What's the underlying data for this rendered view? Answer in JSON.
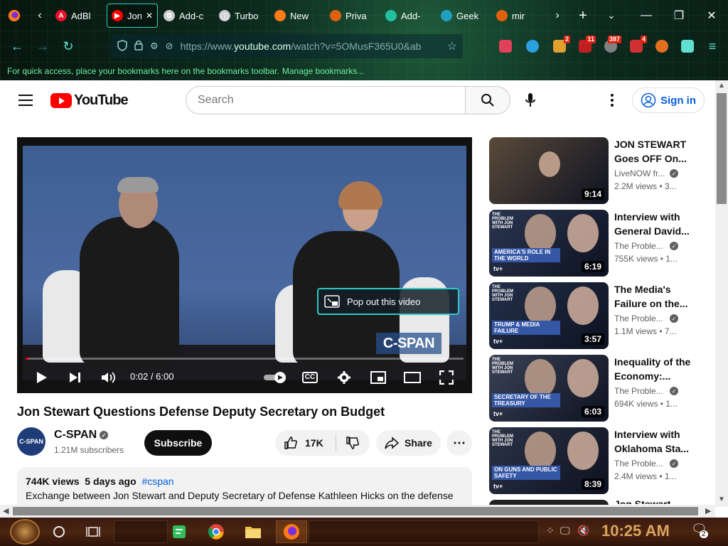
{
  "browser": {
    "tabs": [
      {
        "title": "AdBl",
        "color": "#e8102b",
        "letter": "A"
      },
      {
        "title": "Jon",
        "color": "#ff0000",
        "letter": "▶",
        "active": true
      },
      {
        "title": "Add-c",
        "color": "#cccccc",
        "letter": "⧉"
      },
      {
        "title": "Turbo",
        "color": "#cccccc",
        "letter": "ⓘ"
      },
      {
        "title": "New",
        "color": "#ff7a18",
        "letter": ""
      },
      {
        "title": "Priva",
        "color": "#e06010",
        "letter": ""
      },
      {
        "title": "Add-",
        "color": "#20c0a0",
        "letter": ""
      },
      {
        "title": "Geek",
        "color": "#20a0c0",
        "letter": ""
      },
      {
        "title": "mir",
        "color": "#e06010",
        "letter": ""
      }
    ],
    "url_prefix": "https://www.",
    "url_domain": "youtube.com",
    "url_rest": "/watch?v=5OMusF365U0&ab",
    "extensions": [
      {
        "name": "pocket-icon",
        "color": "#e0405a",
        "badge": ""
      },
      {
        "name": "circle-extension-icon",
        "color": "#2aa0e0",
        "badge": ""
      },
      {
        "name": "lightning-extension-icon",
        "color": "#e0a030",
        "badge": "2"
      },
      {
        "name": "ublock-icon",
        "color": "#c02020",
        "badge": "11"
      },
      {
        "name": "clock-extension-icon",
        "color": "#808080",
        "badge": "387"
      },
      {
        "name": "shield-extension-icon",
        "color": "#d03030",
        "badge": "4"
      },
      {
        "name": "brave-extension-icon",
        "color": "#e07020",
        "badge": ""
      },
      {
        "name": "puzzle-icon",
        "color": "#5fe0d0",
        "badge": ""
      }
    ],
    "bookmarks_text": "For quick access, place your bookmarks here on the bookmarks toolbar.",
    "bookmarks_link": "Manage bookmarks..."
  },
  "youtube": {
    "logo_text": "YouTube",
    "search_placeholder": "Search",
    "signin_label": "Sign in"
  },
  "player": {
    "time": "0:02 / 6:00",
    "progress_fraction": 0.006,
    "popout_label": "Pop out this video",
    "watermark": "C-SPAN",
    "cc_label": "CC"
  },
  "video": {
    "title": "Jon Stewart Questions Defense Deputy Secretary on Budget",
    "channel": "C-SPAN",
    "avatar_text": "C-SPAN",
    "subscribers": "1.21M subscribers",
    "subscribe_label": "Subscribe",
    "likes": "17K",
    "share_label": "Share",
    "views": "744K views",
    "age": "5 days ago",
    "hashtag": "#cspan",
    "description": "Exchange between Jon Stewart and Deputy Secretary of Defense Kathleen Hicks on the defense"
  },
  "related": [
    {
      "title": "JON STEWART Goes OFF On...",
      "channel": "LiveNOW fr...",
      "stats": "2.2M views • 3...",
      "duration": "9:14",
      "caption": "",
      "bg": "#5a4a3a"
    },
    {
      "title": "Interview with General David...",
      "channel": "The Proble...",
      "stats": "755K views • 1...",
      "duration": "6:19",
      "caption": "AMERICA'S ROLE IN THE WORLD",
      "bg": "#2a3550"
    },
    {
      "title": "The Media's Failure on the...",
      "channel": "The Proble...",
      "stats": "1.1M views • 7...",
      "duration": "3:57",
      "caption": "TRUMP & MEDIA FAILURE",
      "bg": "#23304a"
    },
    {
      "title": "Inequality of the Economy:...",
      "channel": "The Proble...",
      "stats": "694K views • 1...",
      "duration": "6:03",
      "caption": "SECRETARY OF THE TREASURY",
      "bg": "#3a4256"
    },
    {
      "title": "Interview with Oklahoma Sta...",
      "channel": "The Proble...",
      "stats": "2.4M views • 1...",
      "duration": "8:39",
      "caption": "ON GUNS AND PUBLIC SAFETY",
      "bg": "#2b3347"
    }
  ],
  "related_peek_title": "Jon Stewart",
  "thumb_brand": "tv+",
  "thumb_top": "THE PROBLEM WITH JON STEWART",
  "taskbar": {
    "clock": "10:25 AM",
    "notification_count": "2"
  }
}
